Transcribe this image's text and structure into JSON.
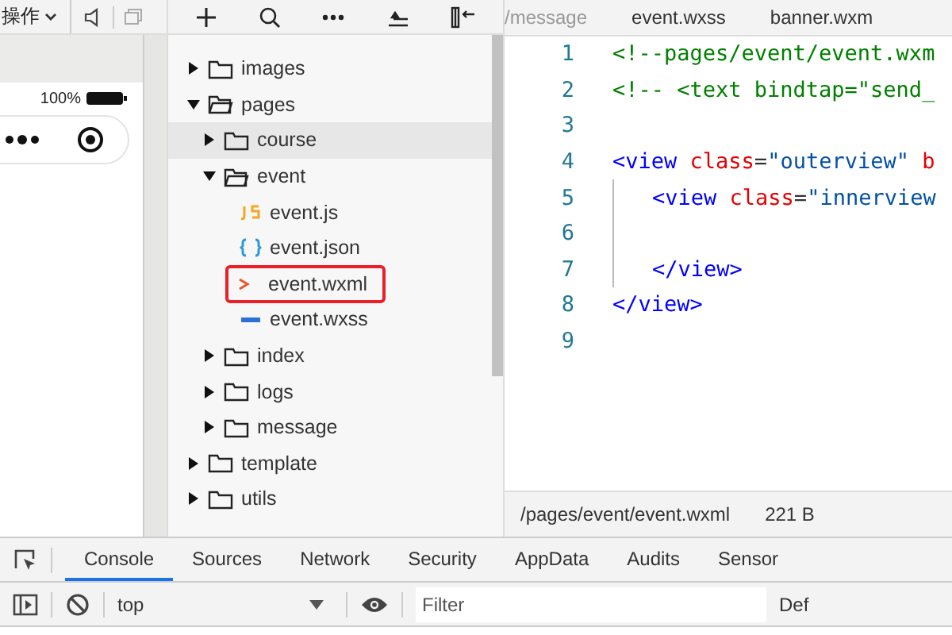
{
  "simulator": {
    "menu": "操作",
    "battery_text": "100%"
  },
  "file_tree": [
    {
      "kind": "folder",
      "name": "images",
      "expanded": false,
      "selected": false
    },
    {
      "kind": "folder",
      "name": "pages",
      "expanded": true,
      "selected": false,
      "children": [
        {
          "kind": "folder",
          "name": "course",
          "expanded": false,
          "selected": true
        },
        {
          "kind": "folder",
          "name": "event",
          "expanded": true,
          "selected": false,
          "children": [
            {
              "kind": "js",
              "name": "event.js",
              "selected": false
            },
            {
              "kind": "json",
              "name": "event.json",
              "selected": false
            },
            {
              "kind": "wxml",
              "name": "event.wxml",
              "selected": false,
              "outlined": true
            },
            {
              "kind": "wxss",
              "name": "event.wxss",
              "selected": false
            }
          ]
        },
        {
          "kind": "folder",
          "name": "index",
          "expanded": false,
          "selected": false
        },
        {
          "kind": "folder",
          "name": "logs",
          "expanded": false,
          "selected": false
        },
        {
          "kind": "folder",
          "name": "message",
          "expanded": false,
          "selected": false
        }
      ]
    },
    {
      "kind": "folder",
      "name": "template",
      "expanded": false,
      "selected": false
    },
    {
      "kind": "folder",
      "name": "utils",
      "expanded": false,
      "selected": false
    }
  ],
  "editor": {
    "tabs": [
      {
        "label": "/message",
        "selected": false
      },
      {
        "label": "event.wxss",
        "selected": false
      },
      {
        "label": "banner.wxm",
        "selected": false
      }
    ],
    "lines": [
      {
        "number": "1",
        "tokens": [
          {
            "kind": "comment",
            "text": "<!--pages/event/event.wxm"
          }
        ]
      },
      {
        "number": "2",
        "tokens": [
          {
            "kind": "comment",
            "text": "<!-- <text bindtap=\"send_"
          }
        ]
      },
      {
        "number": "3"
      },
      {
        "number": "4",
        "tokens": [
          {
            "kind": "tag",
            "text": "<view"
          },
          {
            "kind": "attr",
            "text": " class"
          },
          {
            "kind": "plain",
            "text": "="
          },
          {
            "kind": "string",
            "text": "\"outerview\""
          },
          {
            "kind": "attr",
            "text": " b"
          }
        ]
      },
      {
        "number": "5",
        "indented": true,
        "tokens": [
          {
            "kind": "tag",
            "text": "<view"
          },
          {
            "kind": "attr",
            "text": " class"
          },
          {
            "kind": "plain",
            "text": "="
          },
          {
            "kind": "string",
            "text": "\"innerview"
          }
        ]
      },
      {
        "number": "6",
        "indented": true
      },
      {
        "number": "7",
        "indented": true,
        "tokens": [
          {
            "kind": "tag",
            "text": "</view>"
          }
        ]
      },
      {
        "number": "8",
        "tokens": [
          {
            "kind": "tag",
            "text": "</view>"
          }
        ]
      },
      {
        "number": "9"
      }
    ],
    "status": {
      "path": "/pages/event/event.wxml",
      "size": "221 B"
    }
  },
  "devtools": {
    "tabs": [
      {
        "label": "Console",
        "selected": true
      },
      {
        "label": "Sources",
        "selected": false
      },
      {
        "label": "Network",
        "selected": false
      },
      {
        "label": "Security",
        "selected": false
      },
      {
        "label": "AppData",
        "selected": false
      },
      {
        "label": "Audits",
        "selected": false
      },
      {
        "label": "Sensor",
        "selected": false
      }
    ],
    "context": "top",
    "filter_placeholder": "Filter",
    "levels": "Def"
  }
}
